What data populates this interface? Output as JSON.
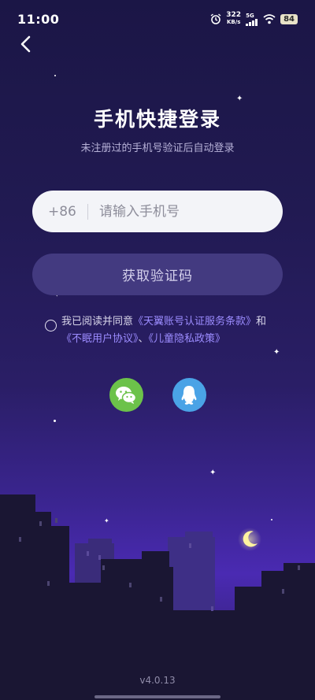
{
  "status_bar": {
    "time": "11:00",
    "speed_value": "322",
    "speed_unit": "KB/s",
    "network": "5G",
    "battery": "84"
  },
  "header": {
    "back_icon": "chevron-left-icon"
  },
  "login": {
    "title": "手机快捷登录",
    "subtitle": "未注册过的手机号验证后自动登录",
    "country_code": "+86",
    "phone_placeholder": "请输入手机号",
    "get_code_label": "获取验证码"
  },
  "agreement": {
    "prefix": "我已阅读并同意",
    "link1": "《天翼账号认证服务条款》",
    "conj": "和",
    "link2": "《不眠用户协议》",
    "sep": "、",
    "link3": "《儿童隐私政策》"
  },
  "social": {
    "wechat_icon": "wechat-icon",
    "qq_icon": "qq-icon"
  },
  "footer": {
    "version": "v4.0.13"
  },
  "colors": {
    "accent": "#9c8cff",
    "button_bg": "#433a80",
    "wechat": "#6cc24a",
    "qq": "#4aa3e6"
  }
}
